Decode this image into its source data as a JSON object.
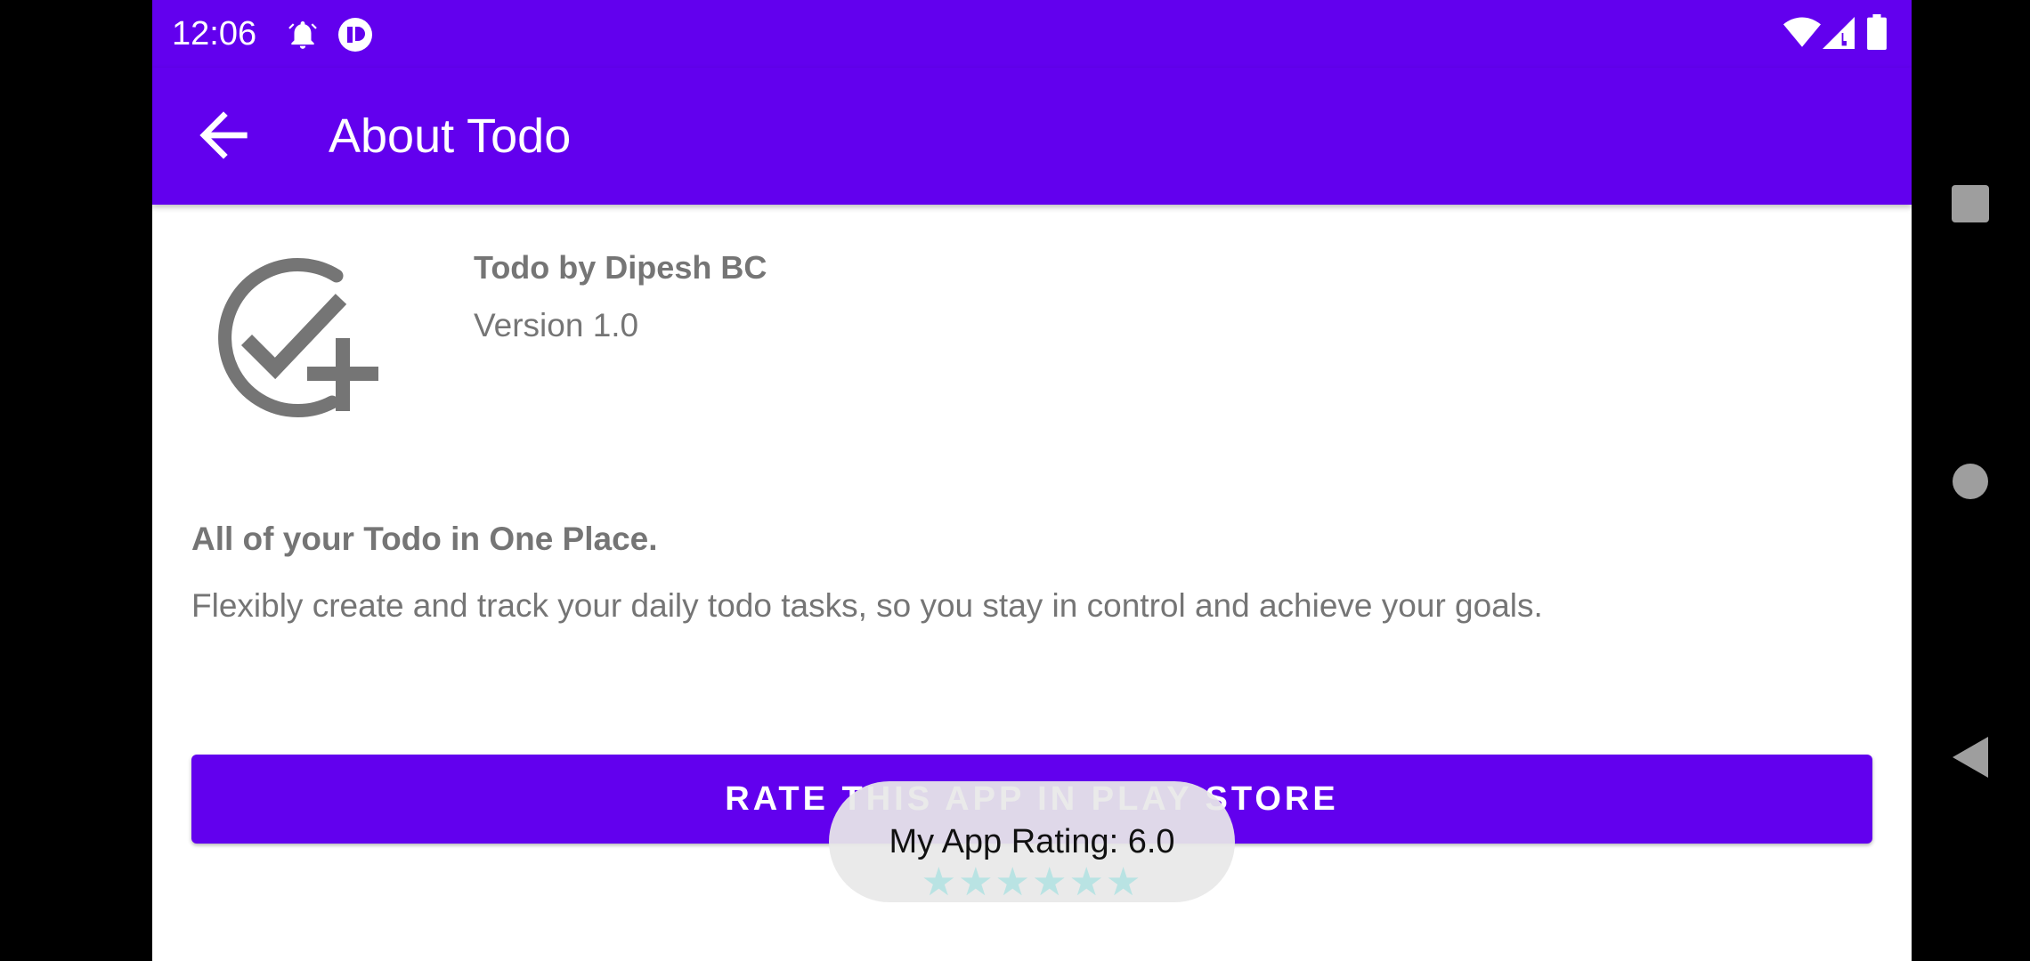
{
  "status_bar": {
    "time": "12:06",
    "left_icons": [
      "alarm-icon",
      "notification-app-icon"
    ],
    "right_icons": [
      "wifi-icon",
      "signal-icon",
      "battery-icon"
    ]
  },
  "app_bar": {
    "back_icon": "arrow-back-icon",
    "title": "About Todo"
  },
  "about": {
    "logo_icon": "check-circle-plus-icon",
    "app_name": "Todo by Dipesh BC",
    "version": "Version 1.0",
    "tagline": "All of your Todo in One Place.",
    "description": "Flexibly create and track your daily todo tasks, so you stay in control and achieve your goals."
  },
  "rate_button": {
    "label": "RATE THIS APP IN PLAY STORE"
  },
  "toast": {
    "text": "My App Rating: 6.0",
    "stars": "★★★★★★"
  },
  "nav_bar": {
    "icons": [
      "recents-icon",
      "home-icon",
      "back-icon"
    ]
  },
  "colors": {
    "primary": "#6200ee",
    "text_secondary": "#757575",
    "background": "#ffffff"
  }
}
